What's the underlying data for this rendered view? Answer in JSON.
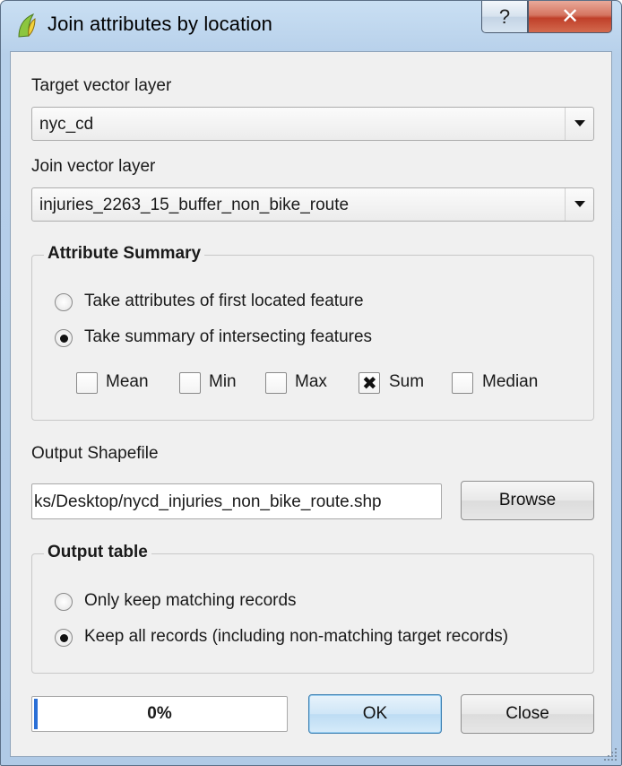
{
  "window": {
    "title": "Join attributes by location",
    "help_glyph": "?",
    "close_glyph": "✕",
    "app_icon": "qgis-logo-icon"
  },
  "target_layer": {
    "label": "Target vector layer",
    "value": "nyc_cd"
  },
  "join_layer": {
    "label": "Join vector layer",
    "value": "injuries_2263_15_buffer_non_bike_route"
  },
  "attribute_summary": {
    "title": "Attribute Summary",
    "option_first": "Take attributes of first located feature",
    "option_summary": "Take summary of intersecting features",
    "selected": "summary",
    "stats": [
      {
        "label": "Mean",
        "checked": false
      },
      {
        "label": "Min",
        "checked": false
      },
      {
        "label": "Max",
        "checked": false
      },
      {
        "label": "Sum",
        "checked": true
      },
      {
        "label": "Median",
        "checked": false
      }
    ]
  },
  "output": {
    "label": "Output Shapefile",
    "path": "ks/Desktop/nycd_injuries_non_bike_route.shp",
    "browse_label": "Browse"
  },
  "output_table": {
    "title": "Output table",
    "option_matching": "Only keep matching records",
    "option_all": "Keep all records (including non-matching target records)",
    "selected": "all"
  },
  "footer": {
    "progress_text": "0%",
    "progress_value": 0,
    "ok_label": "OK",
    "close_label": "Close"
  }
}
